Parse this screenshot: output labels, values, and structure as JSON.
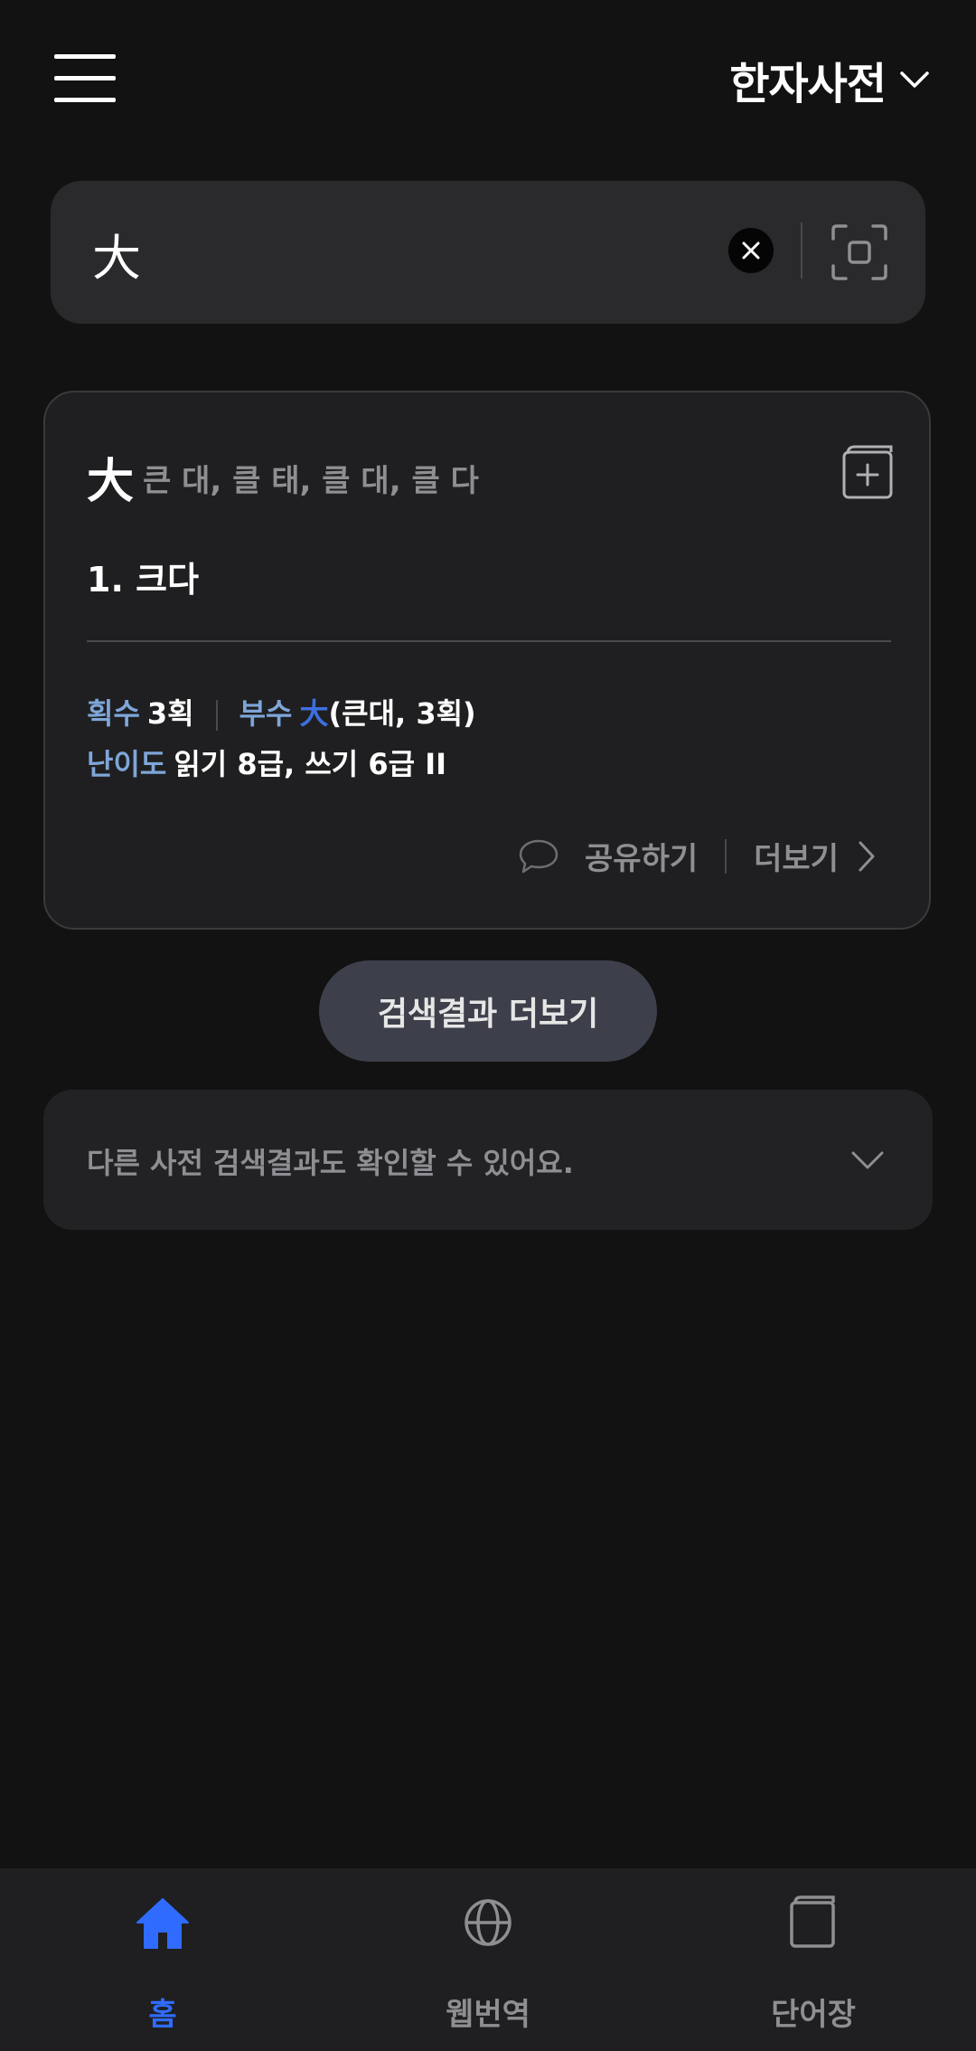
{
  "header": {
    "menu_icon": "hamburger-menu-icon",
    "dictionary_title": "한자사전",
    "dropdown_icon": "chevron-down-icon"
  },
  "search": {
    "value": "大",
    "clear_icon": "close-icon",
    "scan_icon": "scan-icon"
  },
  "result": {
    "hanja": "大",
    "readings": "큰 대, 클 태, 클 대, 클 다",
    "meaning": "1.  크다",
    "strokes_label": "획수",
    "strokes_value": "3획",
    "radical_label": "부수",
    "radical_char": "大",
    "radical_desc": "(큰대, 3획)",
    "difficulty_label": "난이도",
    "difficulty_value": "읽기 8급, 쓰기 6급 II",
    "share_label": "공유하기",
    "more_label": "더보기",
    "add_wordbook_icon": "wordbook-add-icon"
  },
  "more_results_label": "검색결과 더보기",
  "other_dictionaries": {
    "text": "다른 사전 검색결과도 확인할 수 있어요."
  },
  "bottom_nav": {
    "items": [
      {
        "label": "홈",
        "icon": "home-icon",
        "active": true
      },
      {
        "label": "웹번역",
        "icon": "globe-icon",
        "active": false
      },
      {
        "label": "단어장",
        "icon": "book-icon",
        "active": false
      }
    ],
    "active_color": "#2f6bff"
  }
}
